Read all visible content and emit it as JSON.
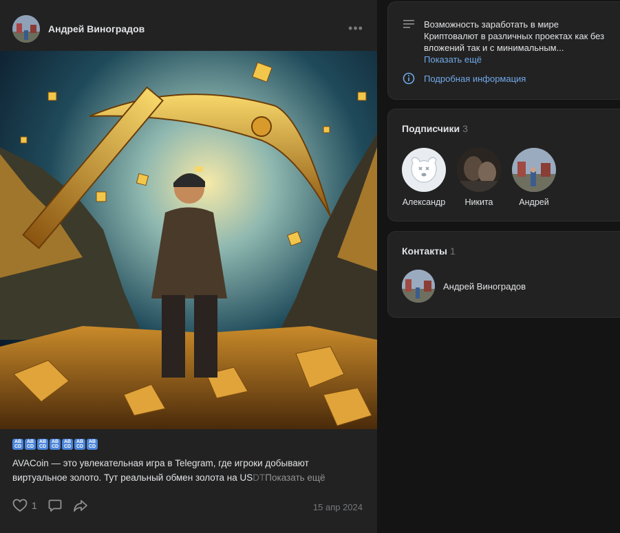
{
  "post": {
    "author": "Андрей Виноградов",
    "more": "•••",
    "emojis": [
      "AB\nCD",
      "AB\nCD",
      "AB\nCD",
      "AB\nCD",
      "AB\nCD",
      "AB\nCD",
      "AB\nCD"
    ],
    "text_main": "AVACoin — это увлекательная игра в Telegram, где игроки добывают виртуальное золото. Тут реальный обмен золота на US",
    "text_fade": "DT",
    "show_more": "Показать ещё",
    "likes": "1",
    "date": "15 апр 2024"
  },
  "info": {
    "description": "Возможность заработать в мире Криптовалют в различных проектах как без вложений так и с минимальным...",
    "show_more": "Показать ещё",
    "details_link": "Подробная информация"
  },
  "subscribers": {
    "title": "Подписчики",
    "count": "3",
    "items": [
      {
        "name": "Александр"
      },
      {
        "name": "Никита"
      },
      {
        "name": "Андрей"
      }
    ]
  },
  "contacts": {
    "title": "Контакты",
    "count": "1",
    "items": [
      {
        "name": "Андрей Виноградов"
      }
    ]
  },
  "colors": {
    "accent_link": "#71aaeb",
    "card_bg": "#222222",
    "page_bg": "#141414"
  }
}
